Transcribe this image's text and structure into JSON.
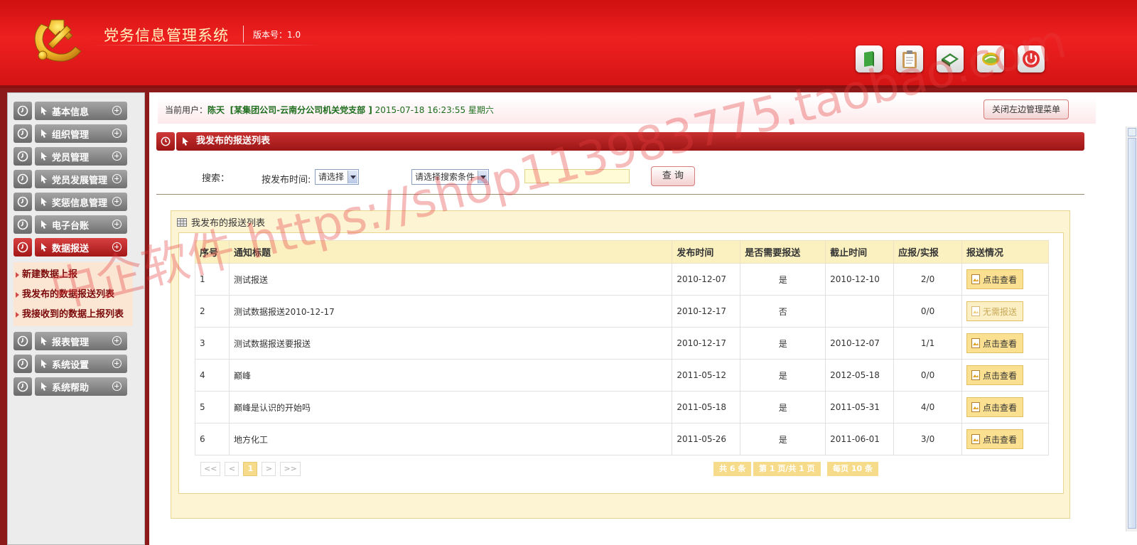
{
  "header": {
    "title": "党务信息管理系统",
    "version": "版本号：1.0",
    "toolbar": [
      {
        "icon": "book-icon"
      },
      {
        "icon": "clipboard-icon"
      },
      {
        "icon": "notebook-icon"
      },
      {
        "icon": "globe-icon"
      },
      {
        "icon": "power-icon"
      }
    ]
  },
  "sidebar": {
    "items": [
      {
        "label": "基本信息"
      },
      {
        "label": "组织管理"
      },
      {
        "label": "党员管理"
      },
      {
        "label": "党员发展管理"
      },
      {
        "label": "奖惩信息管理"
      },
      {
        "label": "电子台账"
      },
      {
        "label": "数据报送",
        "active": true
      },
      {
        "label": "报表管理"
      },
      {
        "label": "系统设置"
      },
      {
        "label": "系统帮助"
      }
    ],
    "submenu": [
      "新建数据上报",
      "我发布的数据报送列表",
      "我接收到的数据上报列表"
    ]
  },
  "user_bar": {
    "prefix": "当前用户：",
    "name": "陈天",
    "org": "[某集团公司-云南分公司机关党支部 ]",
    "datetime": "2015-07-18 16:23:55 星期六",
    "close_menu_label": "关闭左边管理菜单"
  },
  "section": {
    "title": "我发布的报送列表"
  },
  "search": {
    "label": "搜索：",
    "time_label": "按发布时间:",
    "time_select": "请选择",
    "condition_select": "请选择搜索条件",
    "input_value": "",
    "query_label": "查 询"
  },
  "panel": {
    "title": "我发布的报送列表",
    "columns": [
      "序号",
      "通知标题",
      "发布时间",
      "是否需要报送",
      "截止时间",
      "应报/实报",
      "报送情况"
    ],
    "rows": [
      {
        "no": "1",
        "title": "测试报送",
        "date": "2010-12-07",
        "need": "是",
        "deadline": "2010-12-10",
        "ratio": "2/0",
        "action": "点击查看"
      },
      {
        "no": "2",
        "title": "测试数据报送2010-12-17",
        "date": "2010-12-17",
        "need": "否",
        "deadline": "",
        "ratio": "0/0",
        "action": "无需报送"
      },
      {
        "no": "3",
        "title": "测试数据报送要报送",
        "date": "2010-12-17",
        "need": "是",
        "deadline": "2010-12-07",
        "ratio": "1/1",
        "action": "点击查看"
      },
      {
        "no": "4",
        "title": "巅峰",
        "date": "2011-05-12",
        "need": "是",
        "deadline": "2012-05-18",
        "ratio": "0/0",
        "action": "点击查看"
      },
      {
        "no": "5",
        "title": "巅峰是认识的开始吗",
        "date": "2011-05-18",
        "need": "是",
        "deadline": "2011-05-31",
        "ratio": "4/0",
        "action": "点击查看"
      },
      {
        "no": "6",
        "title": "地方化工",
        "date": "2011-05-26",
        "need": "是",
        "deadline": "2011-06-01",
        "ratio": "3/0",
        "action": "点击查看"
      }
    ],
    "pager": {
      "first": "<<",
      "prev": "<",
      "current": "1",
      "next": ">",
      "last": ">>",
      "total": "共 6 条",
      "page": "第 1 页/共 1 页",
      "per_page": "每页 10 条"
    }
  },
  "watermark": "中企软件 https://shop113983775.taobao.com"
}
